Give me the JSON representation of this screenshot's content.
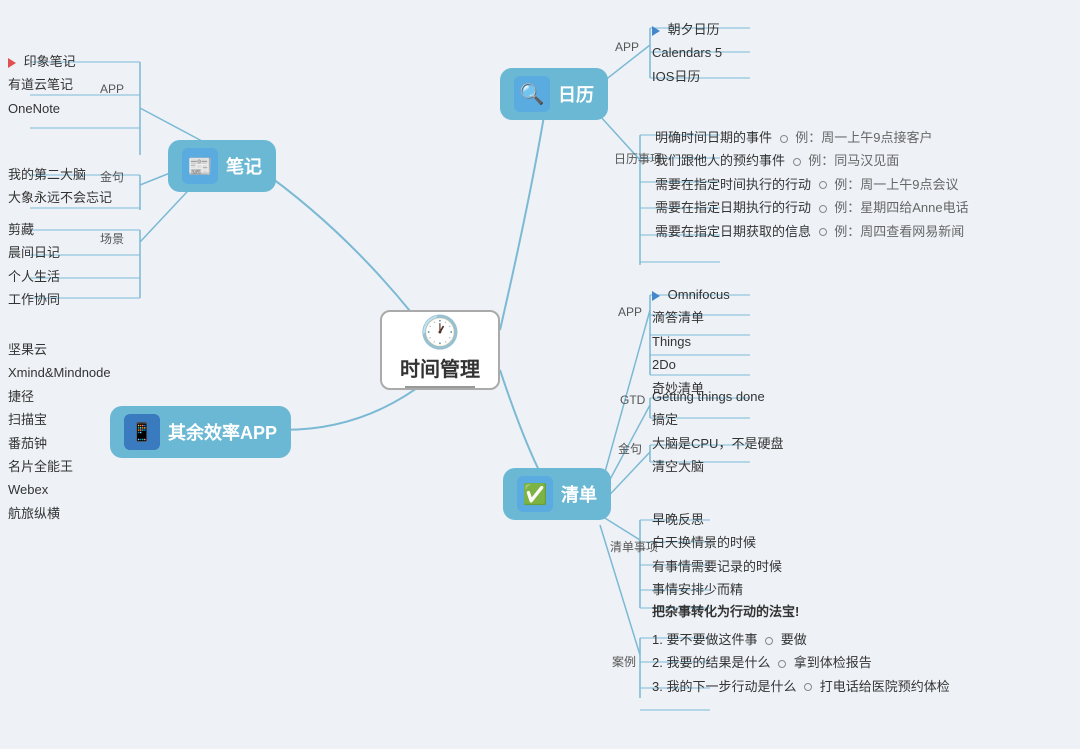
{
  "title": "时间管理",
  "center": {
    "label": "时间管理",
    "icon": "🕐"
  },
  "branches": {
    "note": {
      "label": "笔记",
      "icon": "📰",
      "apps": [
        "印象笔记",
        "有道云笔记",
        "OneNote"
      ],
      "motto": [
        "我的第二大脑",
        "大象永远不会忘记"
      ],
      "scenes": [
        "剪藏",
        "晨间日记",
        "个人生活",
        "工作协同"
      ],
      "app_label": "APP",
      "motto_label": "金句",
      "scene_label": "场景"
    },
    "other": {
      "label": "其余效率APP",
      "icon": "📱",
      "items": [
        "坚果云",
        "Xmind&Mindnode",
        "捷径",
        "扫描宝",
        "番茄钟",
        "名片全能王",
        "Webex",
        "航旅纵横"
      ]
    },
    "calendar": {
      "label": "日历",
      "icon": "🔍",
      "apps": [
        "朝夕日历",
        "Calendars 5",
        "IOS日历"
      ],
      "app_label": "APP",
      "events_label": "日历事项",
      "events": [
        {
          "text": "明确时间日期的事件",
          "example": "例：周一上午9点接客户"
        },
        {
          "text": "我们跟他人的预约事件",
          "example": "例：同马汉见面"
        },
        {
          "text": "需要在指定时间执行的行动",
          "example": "例：周一上午9点会议"
        },
        {
          "text": "需要在指定日期执行的行动",
          "example": "例：星期四给Anne电话"
        },
        {
          "text": "需要在指定日期获取的信息",
          "example": "例：周四查看网易新闻"
        }
      ]
    },
    "checklist": {
      "label": "清单",
      "icon": "✅",
      "app_label": "APP",
      "apps_highlight": "Omnifocus",
      "apps": [
        "滴答清单",
        "Things",
        "2Do",
        "奇妙清单"
      ],
      "gtd_label": "GTD",
      "gtd_items": [
        "Getting things done",
        "搞定"
      ],
      "motto_label": "金句",
      "motto_items": [
        "大脑是CPU，不是硬盘",
        "清空大脑"
      ],
      "list_items_label": "清单事项",
      "list_items": [
        "早晚反思",
        "白天换情景的时候",
        "有事情需要记录的时候",
        "事情安排少而精"
      ],
      "key_text": "把杂事转化为行动的法宝!",
      "cases_label": "案例",
      "cases": [
        {
          "num": "1.",
          "q": "要不要做这件事",
          "a": "要做"
        },
        {
          "num": "2.",
          "q": "我要的结果是什么",
          "a": "拿到体检报告"
        },
        {
          "num": "3.",
          "q": "我的下一步行动是什么",
          "a": "打电话给医院预约体检"
        }
      ]
    }
  }
}
